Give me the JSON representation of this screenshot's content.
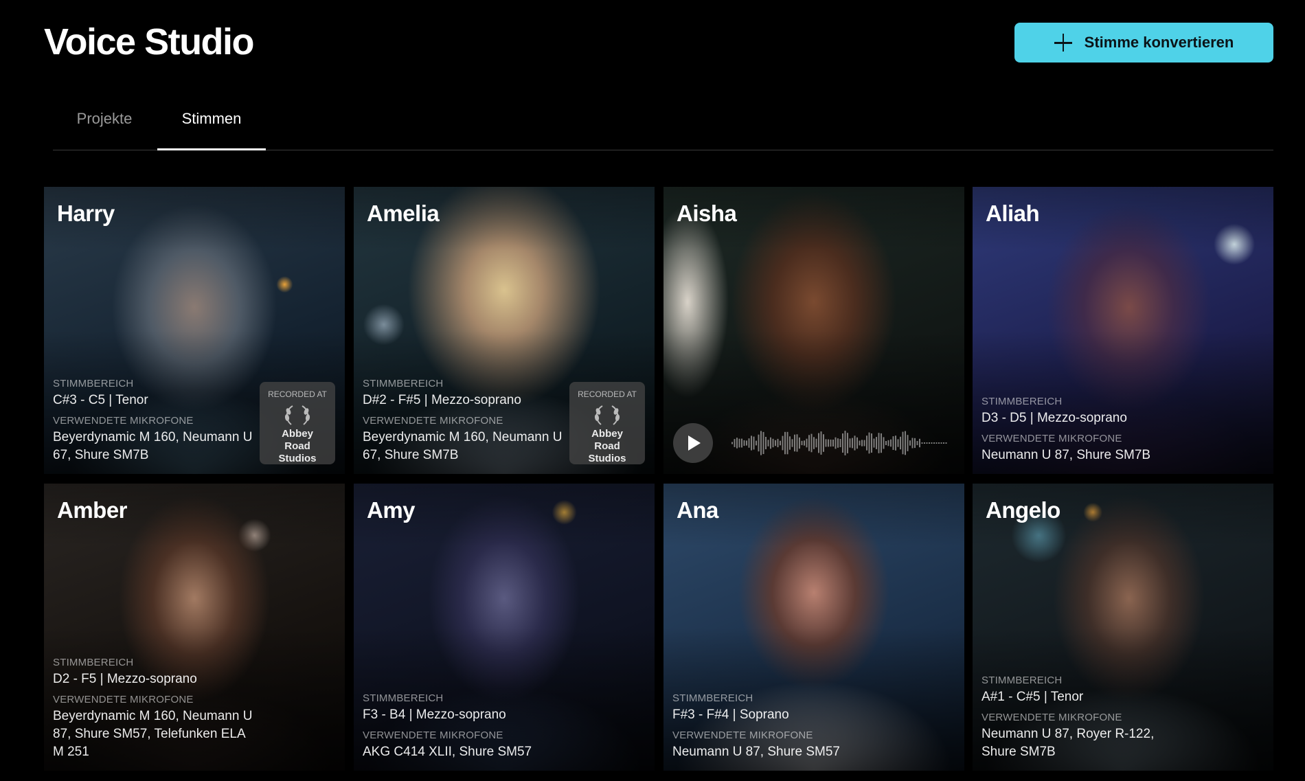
{
  "header": {
    "title": "Voice Studio",
    "cta_label": "Stimme konvertieren"
  },
  "tabs": [
    {
      "label": "Projekte",
      "active": false
    },
    {
      "label": "Stimmen",
      "active": true
    }
  ],
  "labels": {
    "range": "STIMMBEREICH",
    "mics": "VERWENDETE MIKROFONE",
    "recorded_at": "RECORDED AT"
  },
  "voices": [
    {
      "name": "Harry",
      "range": "C#3 - C5 | Tenor",
      "mics": "Beyerdynamic M 160, Neumann U 67, Shure SM7B",
      "studio": "Abbey Road Studios"
    },
    {
      "name": "Amelia",
      "range": "D#2 - F#5 | Mezzo-soprano",
      "mics": "Beyerdynamic M 160, Neumann U 67, Shure SM7B",
      "studio": "Abbey Road Studios"
    },
    {
      "name": "Aisha",
      "playing": true
    },
    {
      "name": "Aliah",
      "range": "D3 - D5 | Mezzo-soprano",
      "mics": "Neumann U 87, Shure SM7B"
    },
    {
      "name": "Amber",
      "range": "D2 - F5 | Mezzo-soprano",
      "mics": "Beyerdynamic M 160, Neumann U 87, Shure SM57, Telefunken ELA M 251"
    },
    {
      "name": "Amy",
      "range": "F3 - B4 | Mezzo-soprano",
      "mics": "AKG C414 XLII, Shure SM57"
    },
    {
      "name": "Ana",
      "range": "F#3 - F#4 | Soprano",
      "mics": "Neumann U 87, Shure SM57"
    },
    {
      "name": "Angelo",
      "range": "A#1 - C#5 | Tenor",
      "mics": "Neumann U 87, Royer R-122, Shure SM7B"
    }
  ],
  "colors": {
    "background": "#000000",
    "accent": "#4fd2e8",
    "tab_inactive": "#9a9a9a"
  },
  "icons": [
    "plus-icon",
    "play-icon",
    "laurel-icon",
    "waveform-icon"
  ]
}
